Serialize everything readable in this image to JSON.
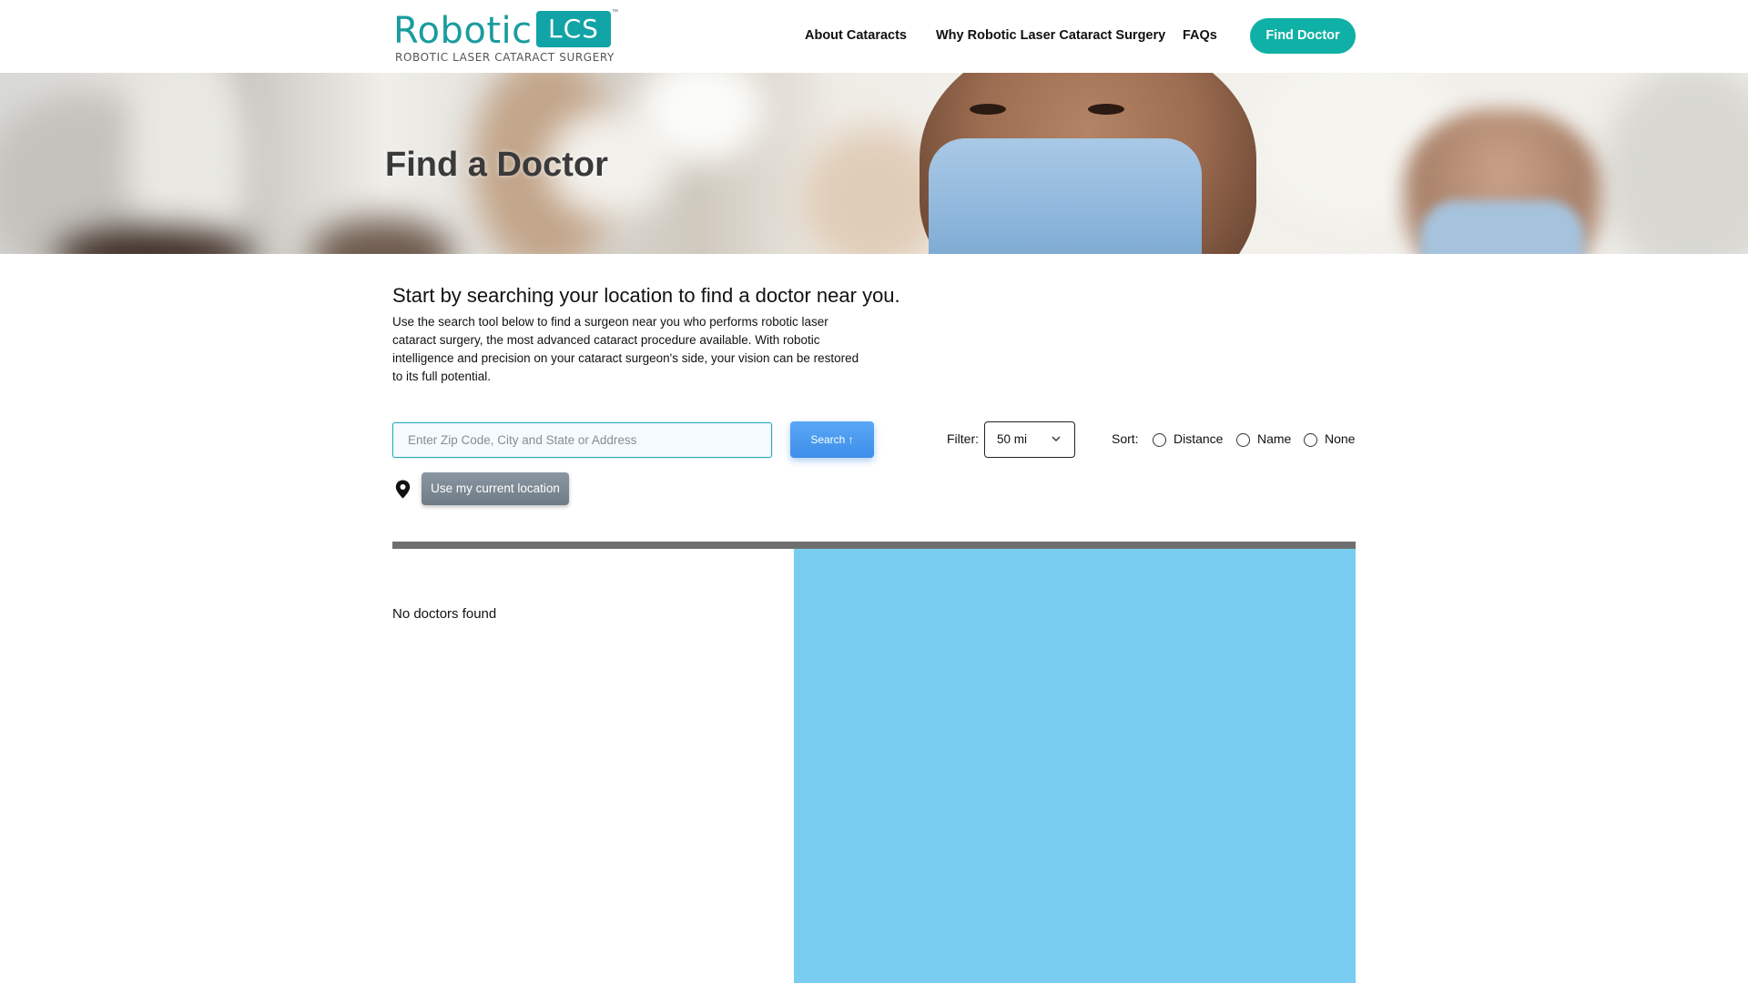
{
  "brand": {
    "logo_word": "Robotic",
    "logo_box": "LCS",
    "logo_tm": "™",
    "logo_subtitle": "ROBOTIC LASER CATARACT SURGERY",
    "primary_color": "#12a3a6"
  },
  "nav": {
    "items": [
      {
        "label": "About Cataracts"
      },
      {
        "label": "Why Robotic Laser Cataract Surgery"
      },
      {
        "label": "FAQs"
      }
    ],
    "cta_label": "Find Doctor",
    "cta_color": "#0fb0a5"
  },
  "hero": {
    "title": "Find a Doctor"
  },
  "intro": {
    "heading": "Start by searching your location to find a doctor near you.",
    "body": "Use the search tool below to find a surgeon near you who performs robotic laser cataract surgery, the most advanced cataract procedure available. With robotic intelligence and precision on your cataract surgeon's side, your vision can be restored to its full potential."
  },
  "search": {
    "placeholder": "Enter Zip Code, City and State or Address",
    "value": "",
    "button_label": "Search ↑",
    "location_button_label": "Use my current location",
    "location_icon": "map-pin-icon"
  },
  "filter": {
    "label": "Filter:",
    "selected": "50 mi",
    "icon": "chevron-down-icon"
  },
  "sort": {
    "label": "Sort:",
    "options": [
      {
        "label": "Distance",
        "checked": false
      },
      {
        "label": "Name",
        "checked": false
      },
      {
        "label": "None",
        "checked": false
      }
    ]
  },
  "results": {
    "empty_message": "No doctors found",
    "map_color": "#78cdf0"
  }
}
